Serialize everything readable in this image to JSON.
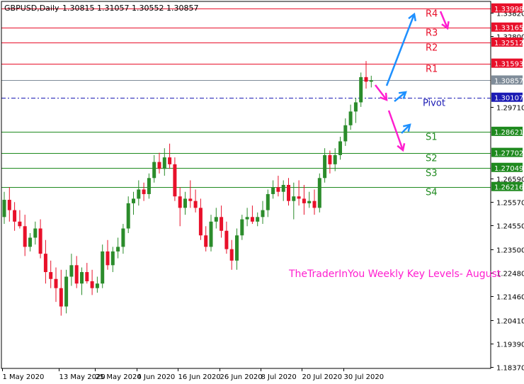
{
  "chart_data": {
    "type": "candlestick",
    "header": {
      "symbol_label": "GBPUSD,Daily",
      "ohlc": "1.30815 1.31057 1.30552 1.30857"
    },
    "y_axis": {
      "min": 1.183,
      "max": 1.343,
      "tick_labels": [
        "1.33820",
        "1.32800",
        "1.29710",
        "1.26590",
        "1.25570",
        "1.24550",
        "1.23500",
        "1.22480",
        "1.21460",
        "1.20410",
        "1.19390",
        "1.18370"
      ]
    },
    "x_axis": {
      "tick_labels": [
        "1 May 2020",
        "13 May 2020",
        "25 May 2020",
        "4 Jun 2020",
        "16 Jun 2020",
        "26 Jun 2020",
        "8 Jul 2020",
        "20 Jul 2020",
        "30 Jul 2020"
      ],
      "tick_bar_index": [
        0,
        11,
        18,
        26,
        34,
        42,
        50,
        58,
        66
      ]
    },
    "levels": [
      {
        "name": "R4",
        "value": 1.33998,
        "value_label": "1.33998",
        "color": "#e8102a",
        "style": "solid"
      },
      {
        "name": "R3",
        "value": 1.33165,
        "value_label": "1.33165",
        "color": "#e8102a",
        "style": "solid"
      },
      {
        "name": "R2",
        "value": 1.32512,
        "value_label": "1.32512",
        "color": "#e8102a",
        "style": "solid"
      },
      {
        "name": "R1",
        "value": 1.31593,
        "value_label": "1.31593",
        "color": "#e8102a",
        "style": "solid"
      },
      {
        "name": "Pivot",
        "value": 1.30107,
        "value_label": "1.30107",
        "color": "#1a1ab4",
        "style": "dashdot"
      },
      {
        "name": "S1",
        "value": 1.28621,
        "value_label": "1.28621",
        "color": "#1f8a1f",
        "style": "solid"
      },
      {
        "name": "S2",
        "value": 1.27702,
        "value_label": "1.27702",
        "color": "#1f8a1f",
        "style": "solid"
      },
      {
        "name": "S3",
        "value": 1.27049,
        "value_label": "1.27049",
        "color": "#1f8a1f",
        "style": "solid"
      },
      {
        "name": "S4",
        "value": 1.26216,
        "value_label": "1.26216",
        "color": "#1f8a1f",
        "style": "solid"
      }
    ],
    "current_price": {
      "value": 1.30857,
      "label": "1.30857",
      "color": "#7f8c99"
    },
    "annotation": "TheTraderInYou Weekly Key Levels- August",
    "colors": {
      "bull": "#2b8c2b",
      "bear": "#e8102a",
      "arrow_up": "#1e90ff",
      "arrow_down": "#ff1ecf",
      "level_green": "#1f8a1f",
      "level_red": "#e8102a"
    },
    "candles": [
      {
        "o": 1.249,
        "h": 1.26,
        "l": 1.246,
        "c": 1.2565
      },
      {
        "o": 1.2565,
        "h": 1.262,
        "l": 1.247,
        "c": 1.252
      },
      {
        "o": 1.252,
        "h": 1.2555,
        "l": 1.243,
        "c": 1.247
      },
      {
        "o": 1.247,
        "h": 1.252,
        "l": 1.244,
        "c": 1.245
      },
      {
        "o": 1.245,
        "h": 1.25,
        "l": 1.232,
        "c": 1.236
      },
      {
        "o": 1.236,
        "h": 1.242,
        "l": 1.234,
        "c": 1.24
      },
      {
        "o": 1.24,
        "h": 1.247,
        "l": 1.237,
        "c": 1.244
      },
      {
        "o": 1.244,
        "h": 1.248,
        "l": 1.231,
        "c": 1.233
      },
      {
        "o": 1.233,
        "h": 1.239,
        "l": 1.22,
        "c": 1.225
      },
      {
        "o": 1.225,
        "h": 1.23,
        "l": 1.218,
        "c": 1.222
      },
      {
        "o": 1.222,
        "h": 1.227,
        "l": 1.212,
        "c": 1.218
      },
      {
        "o": 1.218,
        "h": 1.226,
        "l": 1.206,
        "c": 1.21
      },
      {
        "o": 1.21,
        "h": 1.226,
        "l": 1.207,
        "c": 1.223
      },
      {
        "o": 1.223,
        "h": 1.233,
        "l": 1.219,
        "c": 1.228
      },
      {
        "o": 1.228,
        "h": 1.232,
        "l": 1.218,
        "c": 1.22
      },
      {
        "o": 1.22,
        "h": 1.227,
        "l": 1.215,
        "c": 1.225
      },
      {
        "o": 1.225,
        "h": 1.229,
        "l": 1.22,
        "c": 1.221
      },
      {
        "o": 1.221,
        "h": 1.226,
        "l": 1.215,
        "c": 1.218
      },
      {
        "o": 1.218,
        "h": 1.223,
        "l": 1.216,
        "c": 1.22
      },
      {
        "o": 1.22,
        "h": 1.237,
        "l": 1.218,
        "c": 1.234
      },
      {
        "o": 1.234,
        "h": 1.239,
        "l": 1.226,
        "c": 1.228
      },
      {
        "o": 1.228,
        "h": 1.236,
        "l": 1.225,
        "c": 1.234
      },
      {
        "o": 1.234,
        "h": 1.24,
        "l": 1.231,
        "c": 1.236
      },
      {
        "o": 1.236,
        "h": 1.246,
        "l": 1.233,
        "c": 1.244
      },
      {
        "o": 1.244,
        "h": 1.258,
        "l": 1.242,
        "c": 1.255
      },
      {
        "o": 1.255,
        "h": 1.26,
        "l": 1.25,
        "c": 1.257
      },
      {
        "o": 1.257,
        "h": 1.265,
        "l": 1.254,
        "c": 1.261
      },
      {
        "o": 1.261,
        "h": 1.264,
        "l": 1.256,
        "c": 1.259
      },
      {
        "o": 1.259,
        "h": 1.268,
        "l": 1.257,
        "c": 1.266
      },
      {
        "o": 1.266,
        "h": 1.276,
        "l": 1.264,
        "c": 1.273
      },
      {
        "o": 1.273,
        "h": 1.277,
        "l": 1.268,
        "c": 1.27
      },
      {
        "o": 1.27,
        "h": 1.279,
        "l": 1.267,
        "c": 1.275
      },
      {
        "o": 1.275,
        "h": 1.281,
        "l": 1.27,
        "c": 1.272
      },
      {
        "o": 1.272,
        "h": 1.275,
        "l": 1.256,
        "c": 1.258
      },
      {
        "o": 1.258,
        "h": 1.262,
        "l": 1.245,
        "c": 1.253
      },
      {
        "o": 1.253,
        "h": 1.26,
        "l": 1.25,
        "c": 1.257
      },
      {
        "o": 1.257,
        "h": 1.265,
        "l": 1.253,
        "c": 1.256
      },
      {
        "o": 1.256,
        "h": 1.261,
        "l": 1.251,
        "c": 1.253
      },
      {
        "o": 1.253,
        "h": 1.257,
        "l": 1.239,
        "c": 1.241
      },
      {
        "o": 1.241,
        "h": 1.245,
        "l": 1.234,
        "c": 1.236
      },
      {
        "o": 1.236,
        "h": 1.25,
        "l": 1.234,
        "c": 1.247
      },
      {
        "o": 1.247,
        "h": 1.253,
        "l": 1.244,
        "c": 1.249
      },
      {
        "o": 1.249,
        "h": 1.254,
        "l": 1.24,
        "c": 1.243
      },
      {
        "o": 1.243,
        "h": 1.247,
        "l": 1.233,
        "c": 1.235
      },
      {
        "o": 1.235,
        "h": 1.239,
        "l": 1.226,
        "c": 1.23
      },
      {
        "o": 1.23,
        "h": 1.244,
        "l": 1.226,
        "c": 1.241
      },
      {
        "o": 1.241,
        "h": 1.25,
        "l": 1.239,
        "c": 1.248
      },
      {
        "o": 1.248,
        "h": 1.253,
        "l": 1.245,
        "c": 1.249
      },
      {
        "o": 1.249,
        "h": 1.254,
        "l": 1.246,
        "c": 1.247
      },
      {
        "o": 1.247,
        "h": 1.251,
        "l": 1.245,
        "c": 1.249
      },
      {
        "o": 1.249,
        "h": 1.256,
        "l": 1.246,
        "c": 1.252
      },
      {
        "o": 1.252,
        "h": 1.261,
        "l": 1.249,
        "c": 1.259
      },
      {
        "o": 1.259,
        "h": 1.265,
        "l": 1.257,
        "c": 1.262
      },
      {
        "o": 1.262,
        "h": 1.267,
        "l": 1.258,
        "c": 1.26
      },
      {
        "o": 1.26,
        "h": 1.265,
        "l": 1.256,
        "c": 1.263
      },
      {
        "o": 1.263,
        "h": 1.266,
        "l": 1.254,
        "c": 1.256
      },
      {
        "o": 1.256,
        "h": 1.264,
        "l": 1.248,
        "c": 1.258
      },
      {
        "o": 1.258,
        "h": 1.265,
        "l": 1.254,
        "c": 1.257
      },
      {
        "o": 1.257,
        "h": 1.263,
        "l": 1.25,
        "c": 1.255
      },
      {
        "o": 1.255,
        "h": 1.26,
        "l": 1.253,
        "c": 1.256
      },
      {
        "o": 1.256,
        "h": 1.261,
        "l": 1.25,
        "c": 1.253
      },
      {
        "o": 1.253,
        "h": 1.268,
        "l": 1.251,
        "c": 1.266
      },
      {
        "o": 1.266,
        "h": 1.279,
        "l": 1.264,
        "c": 1.276
      },
      {
        "o": 1.276,
        "h": 1.278,
        "l": 1.268,
        "c": 1.272
      },
      {
        "o": 1.272,
        "h": 1.279,
        "l": 1.269,
        "c": 1.276
      },
      {
        "o": 1.276,
        "h": 1.284,
        "l": 1.274,
        "c": 1.282
      },
      {
        "o": 1.282,
        "h": 1.292,
        "l": 1.28,
        "c": 1.289
      },
      {
        "o": 1.289,
        "h": 1.298,
        "l": 1.287,
        "c": 1.295
      },
      {
        "o": 1.295,
        "h": 1.301,
        "l": 1.29,
        "c": 1.299
      },
      {
        "o": 1.299,
        "h": 1.312,
        "l": 1.297,
        "c": 1.31
      },
      {
        "o": 1.31,
        "h": 1.317,
        "l": 1.305,
        "c": 1.308
      },
      {
        "o": 1.308,
        "h": 1.3106,
        "l": 1.3055,
        "c": 1.3086
      }
    ]
  }
}
